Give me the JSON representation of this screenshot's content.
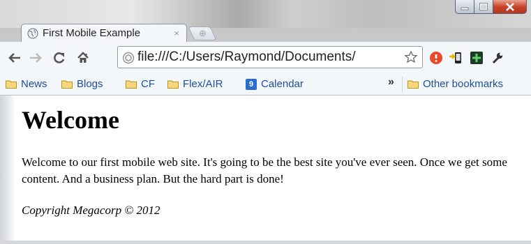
{
  "tab": {
    "title": "First Mobile Example",
    "close": "×"
  },
  "toolbar": {
    "url": "file:///C:/Users/Raymond/Documents/"
  },
  "bookmarks": {
    "items": [
      {
        "label": "News",
        "icon": "folder-icon"
      },
      {
        "label": "Blogs",
        "icon": "folder-icon"
      },
      {
        "label": "CF",
        "icon": "folder-icon"
      },
      {
        "label": "Flex/AIR",
        "icon": "folder-icon"
      },
      {
        "label": "Calendar",
        "icon": "calendar-icon",
        "badge": "9"
      }
    ],
    "overflow": "»",
    "other": "Other bookmarks"
  },
  "page": {
    "heading": "Welcome",
    "body": "Welcome to our first mobile web site. It's going to be the best site you've ever seen. Once we get some content. And a business plan. But the hard part is done!",
    "copyright": "Copyright Megacorp © 2012"
  },
  "colors": {
    "link": "#1b4f9c",
    "chrome": "#f4f7fa",
    "close": "#c8452a"
  }
}
